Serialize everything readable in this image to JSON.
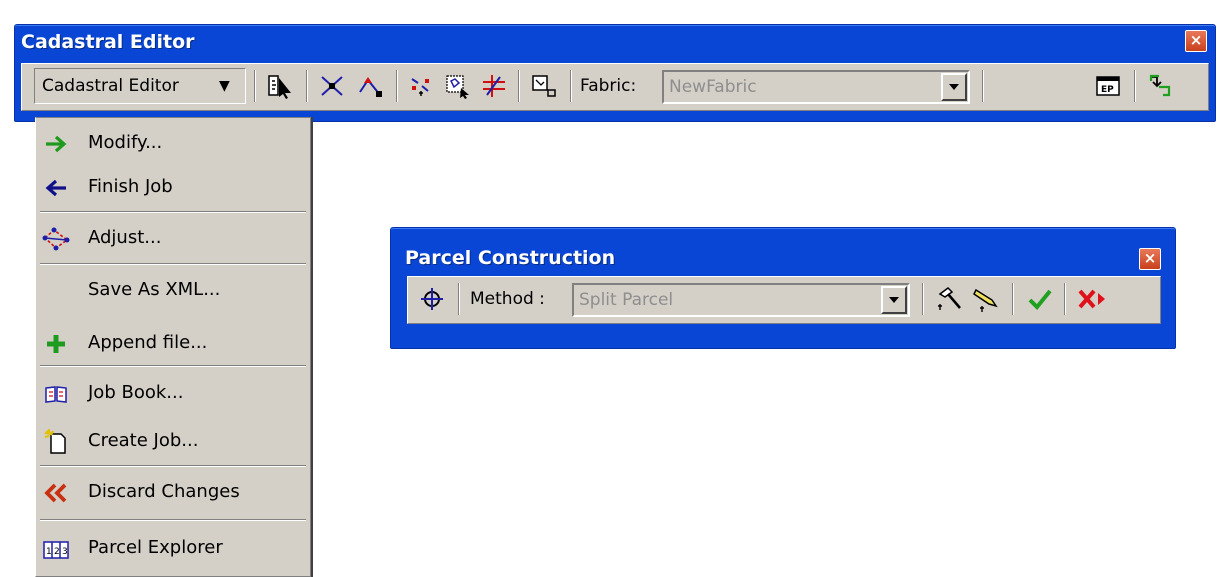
{
  "cadastral_toolbar": {
    "title": "Cadastral Editor",
    "close_label": "×",
    "menu_button_label": "Cadastral Editor",
    "menu_arrow": "▼",
    "fabric_label": "Fabric:",
    "fabric_value": "NewFabric"
  },
  "cadastral_menu": {
    "items": [
      {
        "label": "Modify...",
        "icon": "green-right-arrow-icon"
      },
      {
        "label": "Finish Job",
        "icon": "blue-left-arrow-icon"
      },
      {
        "label": "Adjust...",
        "icon": "adjust-network-icon"
      },
      {
        "label": "Save As XML...",
        "icon": ""
      },
      {
        "label": "Append file...",
        "icon": "green-plus-icon"
      },
      {
        "label": "Job Book...",
        "icon": "book-icon"
      },
      {
        "label": "Create Job...",
        "icon": "new-document-icon"
      },
      {
        "label": "Discard Changes",
        "icon": "double-chevron-left-icon"
      },
      {
        "label": "Parcel Explorer",
        "icon": "parcel-explorer-icon"
      }
    ]
  },
  "parcel_toolbar": {
    "title": "Parcel Construction",
    "close_label": "×",
    "method_label": "Method :",
    "method_value": "Split Parcel"
  },
  "colors": {
    "titlebar_blue": "#0a46d6",
    "toolbar_gray": "#d4d0c8",
    "close_red": "#d4502c",
    "check_green": "#1fa020",
    "cancel_red": "#e0101a"
  }
}
